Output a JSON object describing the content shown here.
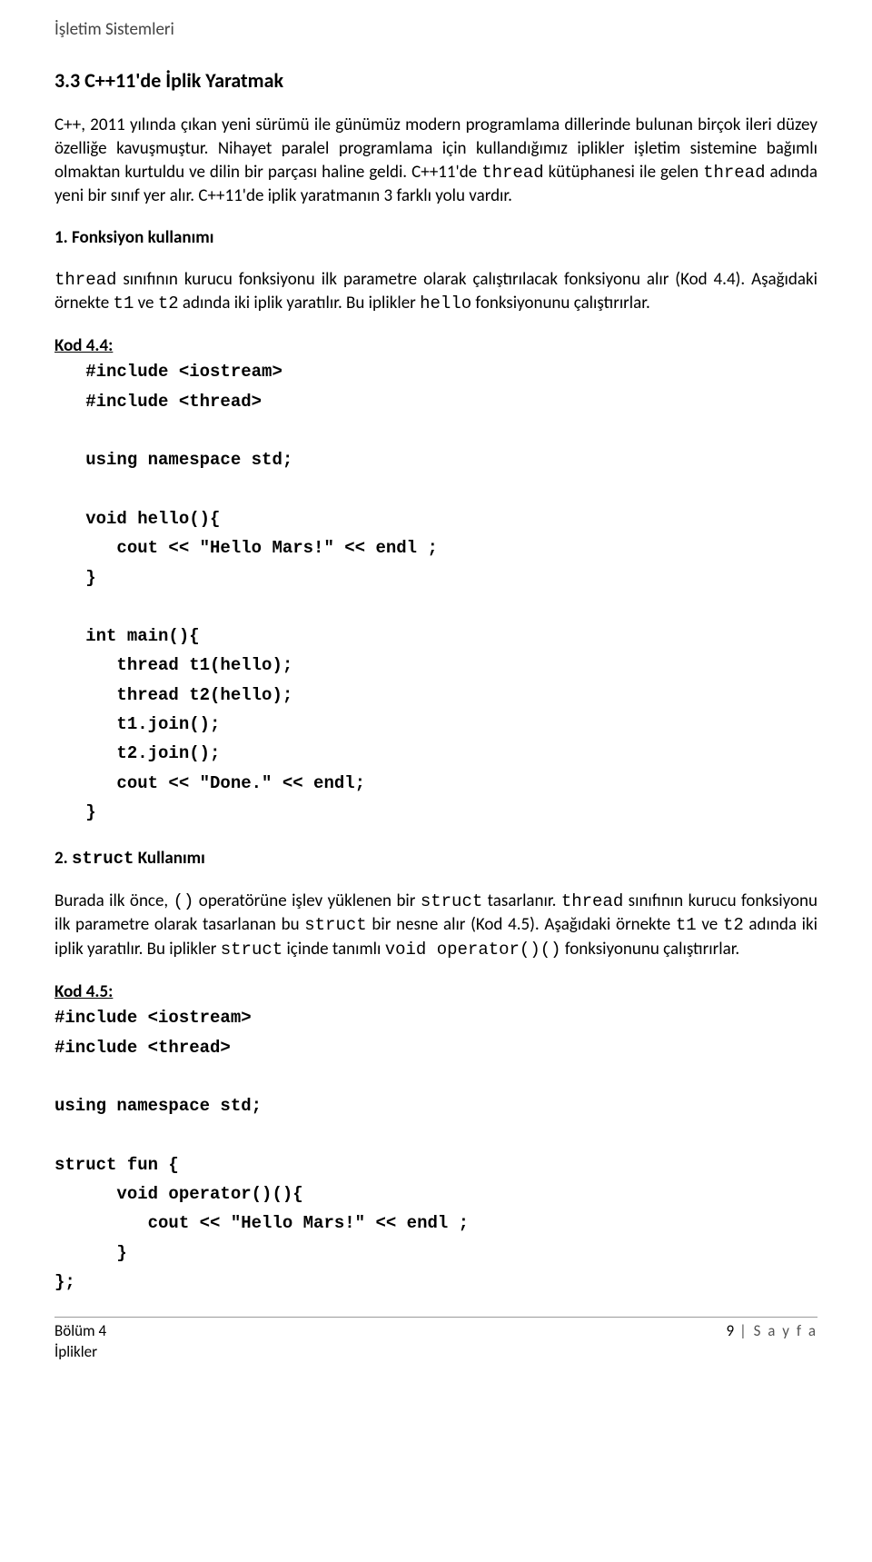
{
  "header": {
    "title": "İşletim Sistemleri"
  },
  "section": {
    "heading": "3.3 C++11'de İplik Yaratmak"
  },
  "para1": {
    "t1": "C++, 2011 yılında çıkan yeni sürümü ile günümüz modern programlama dillerinde bulunan birçok ileri düzey özelliğe kavuşmuştur. Nihayet paralel programlama için kullandığımız iplikler işletim sistemine bağımlı olmaktan kurtuldu ve dilin bir parçası haline geldi. C++11'de ",
    "c1": "thread",
    "t2": " kütüphanesi ile gelen ",
    "c2": "thread",
    "t3": " adında yeni bir sınıf yer alır. C++11'de iplik yaratmanın 3 farklı yolu vardır."
  },
  "sub1": "1. Fonksiyon kullanımı",
  "para2": {
    "c1": "thread",
    "t1": " sınıfının kurucu fonksiyonu ilk parametre olarak çalıştırılacak fonksiyonu alır (Kod 4.4). Aşağıdaki örnekte ",
    "c2": "t1",
    "t2": " ve ",
    "c3": "t2",
    "t3": " adında iki iplik yaratılır. Bu iplikler ",
    "c4": "hello",
    "t4": " fonksiyonunu çalıştırırlar."
  },
  "code1": {
    "label": "Kod 4.4:",
    "body": "   #include <iostream>\n   #include <thread>\n\n   using namespace std;\n\n   void hello(){\n      cout << \"Hello Mars!\" << endl ;\n   }\n\n   int main(){\n      thread t1(hello);\n      thread t2(hello);\n      t1.join();\n      t2.join();\n      cout << \"Done.\" << endl;\n   }"
  },
  "sub2": {
    "prefix": "2. ",
    "code": "struct",
    "suffix": " Kullanımı"
  },
  "para3": {
    "t1": "Burada ilk önce, ",
    "c1": "()",
    "t2": " operatörüne işlev yüklenen bir ",
    "c2": "struct",
    "t3": " tasarlanır. ",
    "c3": "thread",
    "t4": " sınıfının kurucu fonksiyonu ilk parametre olarak tasarlanan bu ",
    "c4": "struct",
    "t5": " bir nesne alır (Kod 4.5). Aşağıdaki örnekte ",
    "c5": "t1",
    "t6": " ve ",
    "c6": "t2",
    "t7": " adında iki iplik yaratılır. Bu iplikler ",
    "c7": "struct",
    "t8": " içinde tanımlı ",
    "c8": "void operator()()",
    "t9": " fonksiyonunu çalıştırırlar."
  },
  "code2": {
    "label": "Kod 4.5:",
    "body": "#include <iostream>\n#include <thread>\n\nusing namespace std;\n\nstruct fun {\n      void operator()(){\n         cout << \"Hello Mars!\" << endl ;\n      }\n};"
  },
  "footer": {
    "left1": "Bölüm 4",
    "left2": "İplikler",
    "pagenum": "9",
    "pagemark": " | S a y f a"
  }
}
